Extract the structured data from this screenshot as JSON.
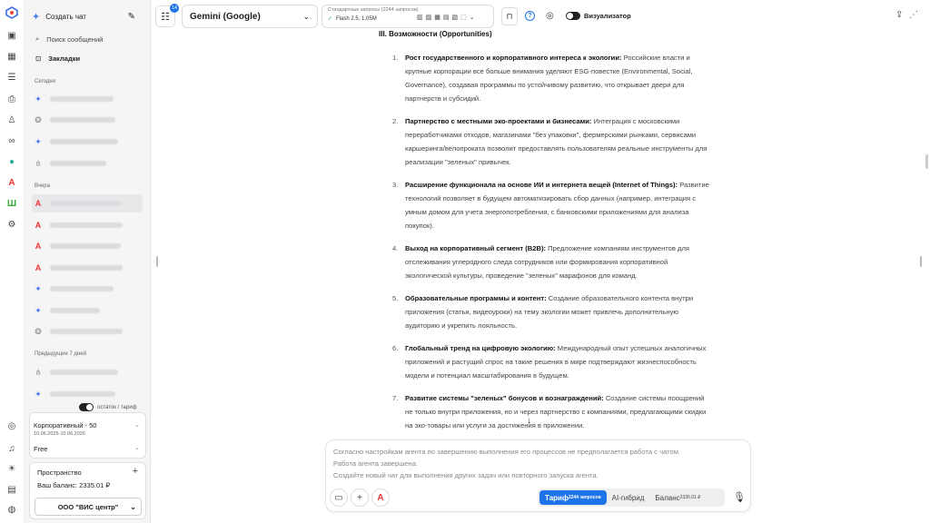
{
  "sidebar": {
    "new_chat": "Создать чат",
    "search": "Поиск сообщений",
    "bookmarks": "Закладки",
    "today": "Сегодня",
    "yesterday": "Вчера",
    "prev7": "Предыдущие 7 дней",
    "toggle_label": "остаток / тариф",
    "plan_name": "Корпоративный - 50",
    "plan_dates": "10.06.2025-10.06.2026",
    "plan_free": "Free",
    "space_title": "Пространство",
    "balance": "Ваш баланс: 2335.01 ₽",
    "org": "ООО \"ВИС центр\""
  },
  "header": {
    "model": "Gemini (Google)",
    "badge": "14",
    "requests_title": "Стандартные запросы (2244 запросов)",
    "model_variant": "Flash 2.5, 1,05M",
    "visualizer": "Визуализатор"
  },
  "content": {
    "heading": "III. Возможности (Opportunities)",
    "items": [
      {
        "n": "1.",
        "title": "Рост государственного и корпоративного интереса к экологии:",
        "text": " Российские власти и крупные корпорации все больше внимания уделяют ESG-повестке (Environmental, Social, Governance), создавая программы по устойчивому развитию, что открывает двери для партнерств и субсидий."
      },
      {
        "n": "2.",
        "title": "Партнерство с местными эко-проектами и бизнесами:",
        "text": " Интеграция с московскими переработчиками отходов, магазинами \"без упаковки\", фермерскими рынками, сервисами каршеринга/велопроката позволит предоставлять пользователям реальные инструменты для реализации \"зеленых\" привычек."
      },
      {
        "n": "3.",
        "title": "Расширение функционала на основе ИИ и интернета вещей (Internet of Things):",
        "text": " Развитие технологий позволяет в будущем автоматизировать сбор данных (например, интеграция с умным домом для учета энергопотребления, с банковскими приложениями для анализа покупок)."
      },
      {
        "n": "4.",
        "title": "Выход на корпоративный сегмент (B2B):",
        "text": " Предложение компаниям инструментов для отслеживания углеродного следа сотрудников или формирования корпоративной экологической культуры, проведение \"зеленых\" марафонов для команд."
      },
      {
        "n": "5.",
        "title": "Образовательные программы и контент:",
        "text": " Создание образовательного контента внутри приложения (статьи, видеоуроки) на тему экологии может привлечь дополнительную аудиторию и укрепить лояльность."
      },
      {
        "n": "6.",
        "title": "Глобальный тренд на цифровую экологию:",
        "text": " Международный опыт успешных аналогичных приложений и растущий спрос на такие решения в мире подтверждают жизнеспособность модели и потенциал масштабирования в будущем."
      },
      {
        "n": "7.",
        "title": "Развитие системы \"зеленых\" бонусов и вознаграждений:",
        "text": " Создание системы поощрений не только внутри приложения, но и через партнерство с компаниями, предлагающими скидки на эко-товары или услуги за достижения в приложении."
      }
    ]
  },
  "input": {
    "line1": "Согласно настройкам агента по завершению выполнения его процессов не предполагается работа с чатом.",
    "line2": "Работа агента завершена.",
    "line3": "Создайте новый чат для выполнения других задач или повторного запуска агента."
  },
  "footer": {
    "tariff": "Тариф",
    "tariff_sup": "2244 запросов",
    "hybrid": "AI-гибрид",
    "balance": "Баланс",
    "balance_sup": "2335.01 ₽"
  },
  "colors": {
    "accent": "#1e74e8"
  }
}
